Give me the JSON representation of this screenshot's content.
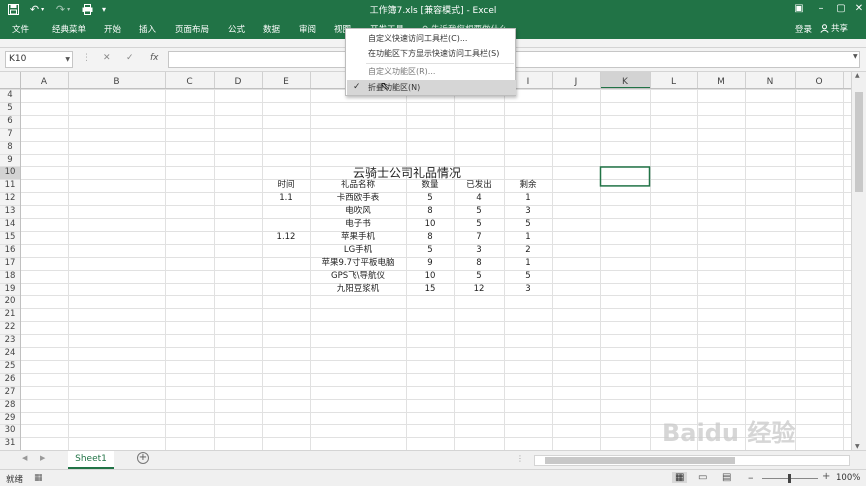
{
  "titlebar": {
    "title": "工作簿7.xls  [兼容模式] - Excel",
    "save_icon": "save-icon",
    "undo_icon": "undo-icon",
    "redo_icon": "redo-icon"
  },
  "ribbon": {
    "tabs": [
      "文件",
      "经典菜单",
      "开始",
      "插入",
      "页面布局",
      "公式",
      "数据",
      "审阅",
      "视图",
      "开发工具"
    ],
    "tell_me": "告诉我您想要做什么...",
    "login": "登录",
    "share": "共享"
  },
  "formula_bar": {
    "name_box": "K10",
    "fx": "fx",
    "cancel": "✕",
    "enter": "✓",
    "formula": ""
  },
  "columns": [
    "A",
    "B",
    "C",
    "D",
    "E",
    "F",
    "G",
    "H",
    "I",
    "J",
    "K",
    "L",
    "M",
    "N",
    "O"
  ],
  "rows": [
    "4",
    "5",
    "6",
    "7",
    "8",
    "9",
    "10",
    "11",
    "12",
    "13",
    "14",
    "15",
    "16",
    "17",
    "18",
    "19",
    "20",
    "21",
    "22",
    "23",
    "24",
    "25",
    "26",
    "27",
    "28",
    "29",
    "30",
    "31"
  ],
  "table": {
    "title": "云骑士公司礼品情况",
    "headers": [
      "时间",
      "礼品名称",
      "数量",
      "已发出",
      "剩余"
    ],
    "rows": [
      [
        "1.1",
        "卡西欧手表",
        "5",
        "4",
        "1"
      ],
      [
        "",
        "电吹风",
        "8",
        "5",
        "3"
      ],
      [
        "",
        "电子书",
        "10",
        "5",
        "5"
      ],
      [
        "1.12",
        "苹果手机",
        "8",
        "7",
        "1"
      ],
      [
        "",
        "LG手机",
        "5",
        "3",
        "2"
      ],
      [
        "",
        "苹果9.7寸平板电脑",
        "9",
        "8",
        "1"
      ],
      [
        "",
        "GPS飞\\导航仪",
        "10",
        "5",
        "5"
      ],
      [
        "",
        "九阳豆浆机",
        "15",
        "12",
        "3"
      ]
    ]
  },
  "context_menu": {
    "items": [
      {
        "label": "自定义快速访问工具栏(C)...",
        "enabled": true
      },
      {
        "label": "在功能区下方显示快速访问工具栏(S)",
        "enabled": true
      },
      {
        "label": "自定义功能区(R)...",
        "enabled": false
      },
      {
        "label": "折叠功能区(N)",
        "enabled": true,
        "checked": true,
        "highlighted": true
      }
    ]
  },
  "sheet_tabs": [
    "Sheet1"
  ],
  "status": {
    "ready": "就绪",
    "zoom": "100%"
  },
  "watermark": "Baidu 经验",
  "colors": {
    "brand": "#217346",
    "selection": "#217346",
    "grid_line": "#e1e1e1"
  }
}
